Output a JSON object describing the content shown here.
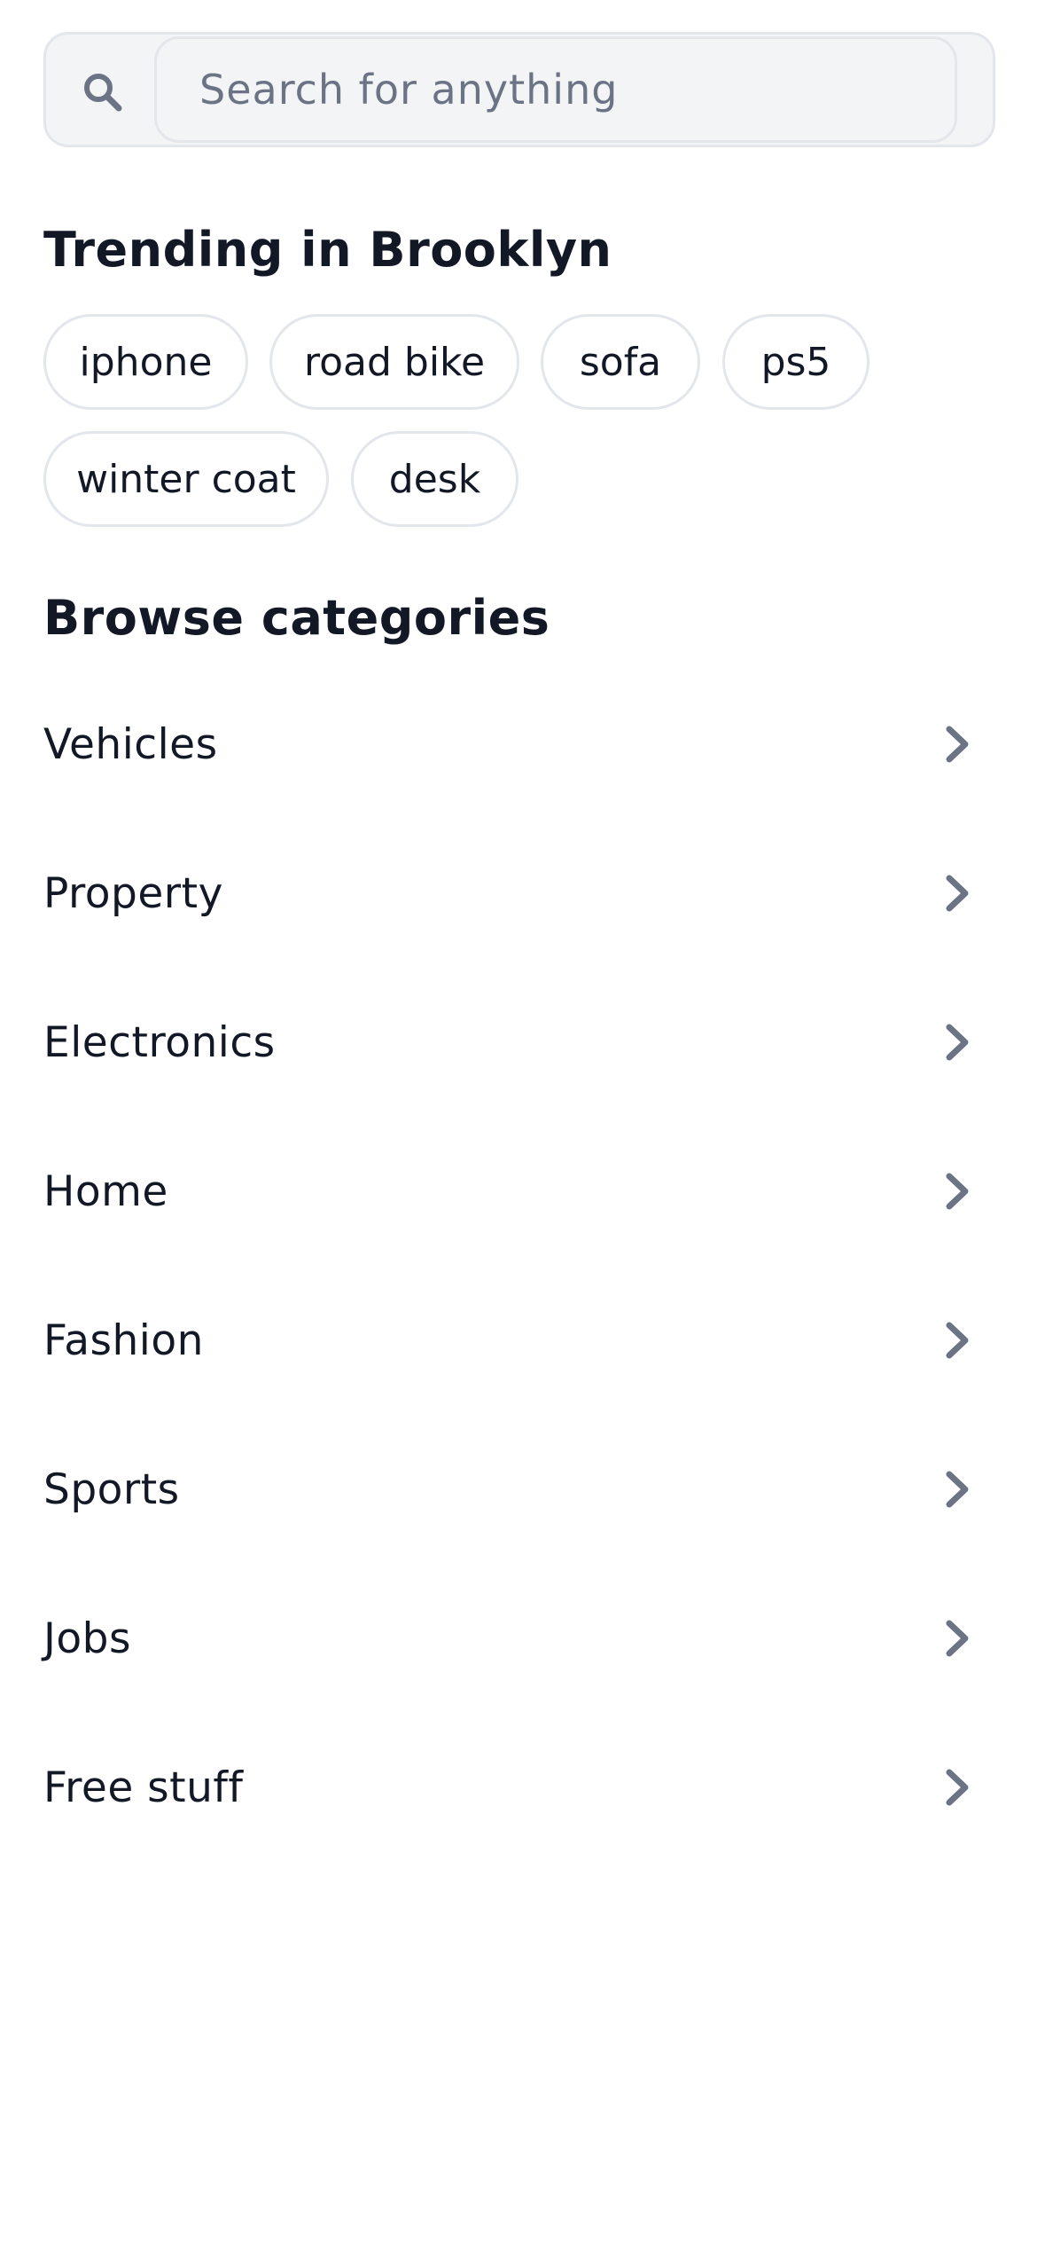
{
  "search": {
    "placeholder": "Search for anything",
    "value": "",
    "icon": "search-icon"
  },
  "trending": {
    "title": "Trending in Brooklyn",
    "chips": [
      "iphone",
      "road bike",
      "sofa",
      "ps5",
      "winter coat",
      "desk"
    ]
  },
  "categories": {
    "title": "Browse categories",
    "items": [
      {
        "label": "Vehicles"
      },
      {
        "label": "Property"
      },
      {
        "label": "Electronics"
      },
      {
        "label": "Home"
      },
      {
        "label": "Fashion"
      },
      {
        "label": "Sports"
      },
      {
        "label": "Jobs"
      },
      {
        "label": "Free stuff"
      }
    ],
    "chevron_icon": "chevron-right-icon"
  },
  "colors": {
    "text": "#121826",
    "muted": "#6b7385",
    "border": "#e3e6eb",
    "search_bg": "#f3f4f6",
    "chevron": "#6b7385"
  }
}
